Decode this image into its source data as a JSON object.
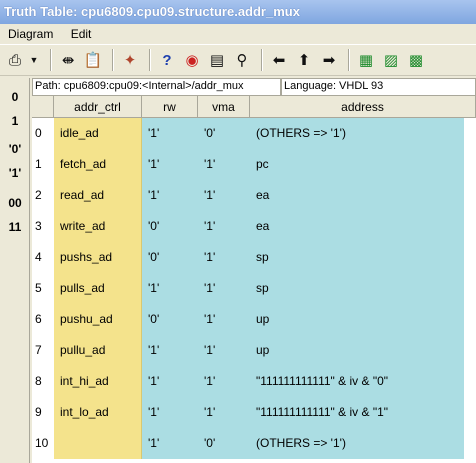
{
  "window": {
    "title": "Truth Table: cpu6809.cpu09.structure.addr_mux"
  },
  "menu": {
    "items": [
      "Diagram",
      "Edit"
    ]
  },
  "toolbar": {
    "icons": [
      "print-icon",
      "dropdown-icon",
      "split-view-icon",
      "paste-icon",
      "wand-icon",
      "help-icon",
      "target-icon",
      "notepad-icon",
      "zoom-icon",
      "arrow-left-icon",
      "arrow-up-icon",
      "arrow-right-icon",
      "expand-columns-icon",
      "insert-column-icon",
      "insert-row-icon"
    ]
  },
  "left_values": [
    "0",
    "1",
    "'0'",
    "'1'",
    "00",
    "11"
  ],
  "path_bar": {
    "path": "Path: cpu6809:cpu09:<Internal>/addr_mux",
    "language": "Language: VHDL 93"
  },
  "table": {
    "headers": [
      "addr_ctrl",
      "rw",
      "vma",
      "address"
    ],
    "rows": [
      {
        "n": "0",
        "addr_ctrl": "idle_ad",
        "rw": "'1'",
        "vma": "'0'",
        "address": "(OTHERS => '1')"
      },
      {
        "n": "1",
        "addr_ctrl": "fetch_ad",
        "rw": "'1'",
        "vma": "'1'",
        "address": "pc"
      },
      {
        "n": "2",
        "addr_ctrl": "read_ad",
        "rw": "'1'",
        "vma": "'1'",
        "address": "ea"
      },
      {
        "n": "3",
        "addr_ctrl": "write_ad",
        "rw": "'0'",
        "vma": "'1'",
        "address": "ea"
      },
      {
        "n": "4",
        "addr_ctrl": "pushs_ad",
        "rw": "'0'",
        "vma": "'1'",
        "address": "sp"
      },
      {
        "n": "5",
        "addr_ctrl": "pulls_ad",
        "rw": "'1'",
        "vma": "'1'",
        "address": "sp"
      },
      {
        "n": "6",
        "addr_ctrl": "pushu_ad",
        "rw": "'0'",
        "vma": "'1'",
        "address": "up"
      },
      {
        "n": "7",
        "addr_ctrl": "pullu_ad",
        "rw": "'1'",
        "vma": "'1'",
        "address": "up"
      },
      {
        "n": "8",
        "addr_ctrl": "int_hi_ad",
        "rw": "'1'",
        "vma": "'1'",
        "address": "\"111111111111\" & iv & \"0\""
      },
      {
        "n": "9",
        "addr_ctrl": "int_lo_ad",
        "rw": "'1'",
        "vma": "'1'",
        "address": "\"111111111111\" & iv & \"1\""
      },
      {
        "n": "10",
        "addr_ctrl": "",
        "rw": "'1'",
        "vma": "'0'",
        "address": "(OTHERS => '1')"
      }
    ]
  },
  "colors": {
    "input_column": "#f4e38c",
    "output_columns": "#abdde3",
    "title_bar": "#8fb0e6"
  }
}
